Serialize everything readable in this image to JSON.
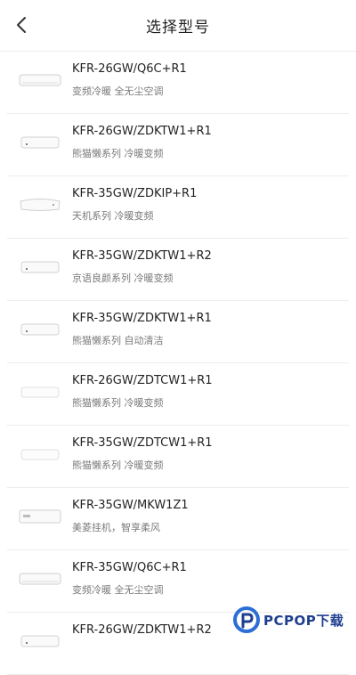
{
  "header": {
    "title": "选择型号",
    "back_icon": "chevron-left-icon"
  },
  "items": [
    {
      "model": "KFR-26GW/Q6C+R1",
      "desc": "变频冷暖 全无尘空调"
    },
    {
      "model": "KFR-26GW/ZDKTW1+R1",
      "desc": "熊猫懒系列 冷暖变频"
    },
    {
      "model": "KFR-35GW/ZDKIP+R1",
      "desc": "天机系列 冷暖变频"
    },
    {
      "model": "KFR-35GW/ZDKTW1+R2",
      "desc": "京语良颜系列 冷暖变频"
    },
    {
      "model": "KFR-35GW/ZDKTW1+R1",
      "desc": "熊猫懒系列 自动清洁"
    },
    {
      "model": "KFR-26GW/ZDTCW1+R1",
      "desc": "熊猫懒系列 冷暖变频"
    },
    {
      "model": "KFR-35GW/ZDTCW1+R1",
      "desc": "熊猫懒系列 冷暖变频"
    },
    {
      "model": "KFR-35GW/MKW1Z1",
      "desc": "美菱挂机，智享柔风"
    },
    {
      "model": "KFR-35GW/Q6C+R1",
      "desc": "变频冷暖 全无尘空调"
    },
    {
      "model": "KFR-26GW/ZDKTW1+R2",
      "desc": ""
    }
  ],
  "watermark": {
    "text": "PCPOP下载"
  }
}
